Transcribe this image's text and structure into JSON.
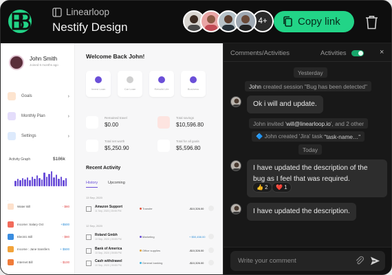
{
  "header": {
    "project": "Linearloop",
    "title": "Nestify Design",
    "more_collaborators": "4+",
    "copy_label": "Copy link",
    "accent": "#22d487"
  },
  "preview": {
    "user_name": "John Smith",
    "joined": "Joined 6 months ago",
    "nav": [
      "Goals",
      "Monthly Plan",
      "Settings"
    ],
    "activity_title": "Activity Graph",
    "activity_value": "$186k",
    "transactions": [
      {
        "label": "Water Bill",
        "amount": "- $80"
      },
      {
        "label": "Income: Salary Oct",
        "amount": "+$500"
      },
      {
        "label": "Electric Bill",
        "amount": "- $80"
      },
      {
        "label": "Income : Jane transfers",
        "amount": "+ $500"
      },
      {
        "label": "Internet Bill",
        "amount": "- $100"
      }
    ],
    "welcome": "Welcome Back John!",
    "quick_actions": [
      "Invest Loan",
      "Car Loan",
      "Rebuild Life",
      "Business"
    ],
    "stats": [
      {
        "label": "Remained travel",
        "value": "$0.00"
      },
      {
        "label": "Total savings",
        "value": "$10,596.80"
      },
      {
        "label": "Total net worth",
        "value": "$5,250.90"
      },
      {
        "label": "Total for all goals",
        "value": "$5,596.80"
      }
    ],
    "recent_title": "Recent Activity",
    "tabs": [
      "History",
      "Upcoming"
    ],
    "date_1": "13 Sep, 2020",
    "date_2": "12 Sep, 2020",
    "rows": [
      {
        "name": "Amazon Support",
        "date": "11 Sep, 2020 | 05:55 PM",
        "cat": "Transfer",
        "amount": "-$10,326.00"
      },
      {
        "name": "Roland Gmbh",
        "date": "10 Sep, 2020 | 05:55 PM",
        "cat": "Marketing",
        "amount": "+ $50,458.00"
      },
      {
        "name": "Bank of America",
        "date": "10 Sep, 2020 | 05:55 PM",
        "cat": "Office supplies",
        "amount": "-$10,326.00"
      },
      {
        "name": "Cash withdrawel",
        "date": "10 Sep, 2020 | 05:55 PM",
        "cat": "General banking",
        "amount": "-$10,326.00"
      }
    ]
  },
  "panel": {
    "title": "Comments/Activities",
    "toggle_label": "Activities",
    "close": "×",
    "day1": "Yesterday",
    "event1_user": "John",
    "event1_text": "created session \"Bug has been detected\"",
    "msg1": "Ok i will and update.",
    "event2_user": "John",
    "event2_mid": "invited",
    "event2_email": "will@linearloop.io",
    "event2_rest": ", and 2 other",
    "event3_prefix": "🔷 John created 'Jira' task",
    "event3_code": "\"task-name…\"",
    "day2": "Today",
    "msg2": "I have updated the description of the bug as I feel that was required.",
    "react1": "👍 2",
    "react2": "❤️ 1",
    "msg3": "I have updated the description.",
    "placeholder": "Write your comment"
  }
}
